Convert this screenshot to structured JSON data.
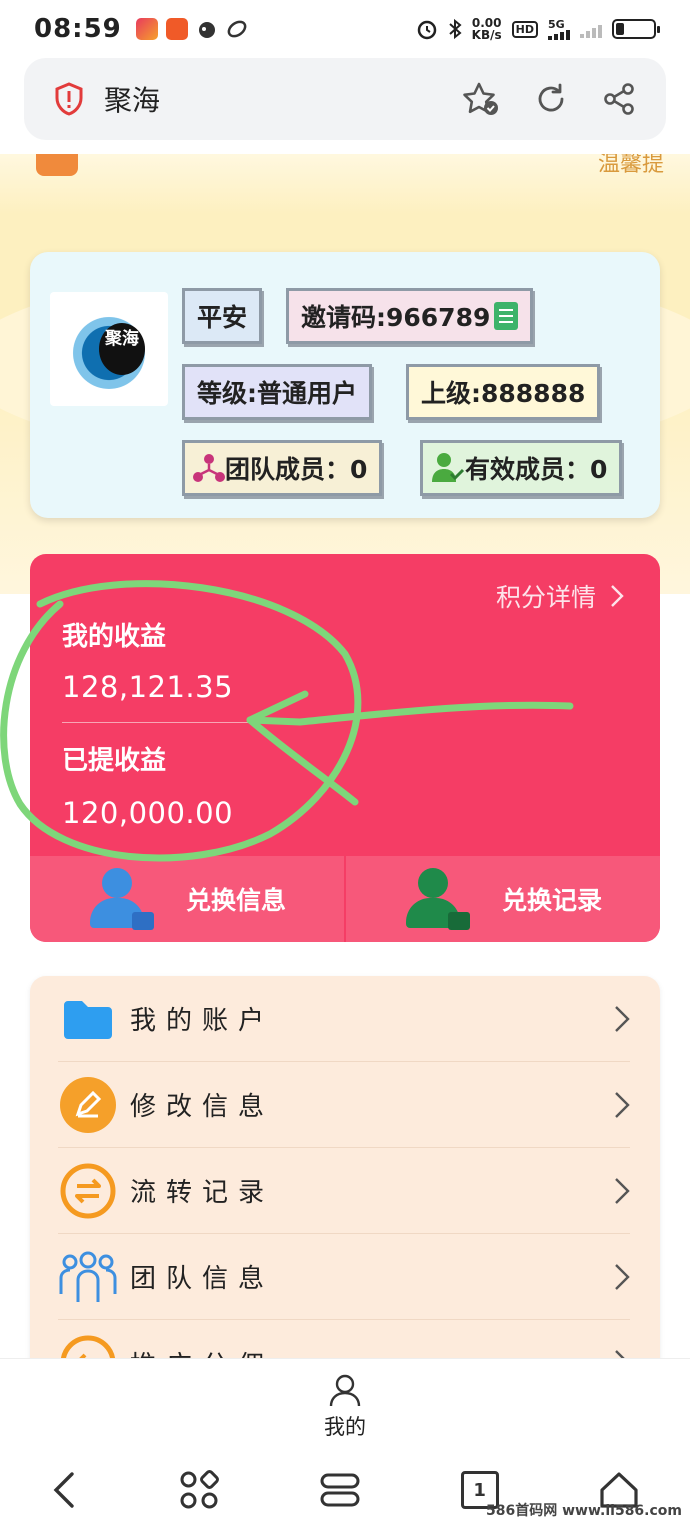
{
  "status_bar": {
    "time": "08:59",
    "net_speed_value": "0.00",
    "net_speed_unit": "KB/s",
    "hd_label": "HD",
    "signal_label": "5G"
  },
  "browser": {
    "title": "聚海"
  },
  "notice": {
    "text": "温馨提"
  },
  "profile": {
    "logo_text": "聚海",
    "name": "平安",
    "invite_code": "邀请码:966789",
    "level": "等级:普通用户",
    "parent": "上级:888888",
    "team_members": "团队成员：0",
    "valid_members": "有效成员：0"
  },
  "earnings": {
    "points_detail": "积分详情",
    "my_income_label": "我的收益",
    "my_income_value": "128,121.35",
    "withdrawn_label": "已提收益",
    "withdrawn_value": "120,000.00",
    "exchange_info": "兑换信息",
    "exchange_record": "兑换记录"
  },
  "menu": {
    "items": [
      {
        "label": "我的账户",
        "icon": "folder-icon"
      },
      {
        "label": "修改信息",
        "icon": "edit-icon"
      },
      {
        "label": "流转记录",
        "icon": "transfer-icon"
      },
      {
        "label": "团队信息",
        "icon": "team-icon"
      },
      {
        "label": "推广分佣",
        "icon": "promotion-icon"
      }
    ]
  },
  "tab_bar": {
    "mine": "我的"
  },
  "system_nav": {
    "tab_count": "1"
  },
  "watermark": "586首码网 www.ll586.com",
  "colors": {
    "earn_card": "#f53d65",
    "profile_card": "#e9f8fb",
    "menu_card": "#fdebdc",
    "annotation_green": "#7ed67a"
  }
}
